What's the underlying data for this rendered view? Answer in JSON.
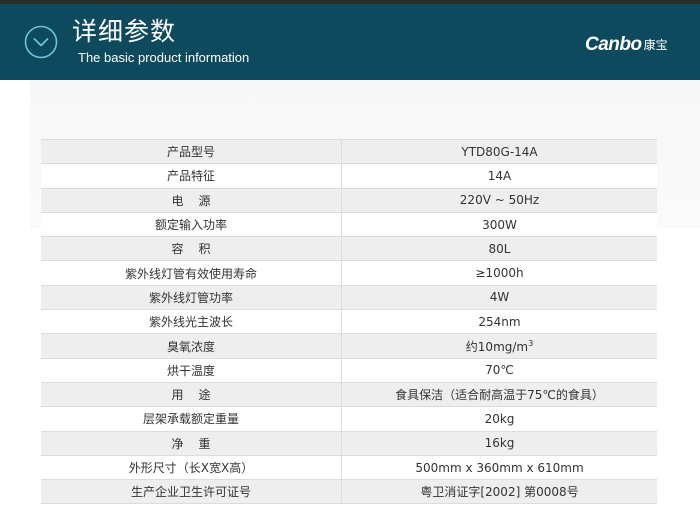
{
  "header": {
    "icon": "chevron-down-circle-icon",
    "title": "详细参数",
    "subtitle": "The basic product information",
    "brand_latin": "Canbo",
    "brand_cn": "康宝",
    "background": "#0d4a5e"
  },
  "specs": [
    {
      "label": "产品型号",
      "value": "YTD80G-14A"
    },
    {
      "label": "产品特征",
      "value": "14A"
    },
    {
      "label": "电源",
      "value": "220V ~ 50Hz"
    },
    {
      "label": "额定输入功率",
      "value": "300W"
    },
    {
      "label": "容积",
      "value": "80L"
    },
    {
      "label": "紫外线灯管有效使用寿命",
      "value": "≥1000h"
    },
    {
      "label": "紫外线灯管功率",
      "value": "4W"
    },
    {
      "label": "紫外线光主波长",
      "value": "254nm"
    },
    {
      "label": "臭氧浓度",
      "value": "约10mg/m",
      "value_sup": "3"
    },
    {
      "label": "烘干温度",
      "value": "70℃"
    },
    {
      "label": "用途",
      "value": "食具保洁（适合耐高温于75℃的食具）"
    },
    {
      "label": "层架承载额定重量",
      "value": "20kg"
    },
    {
      "label": "净重",
      "value": "16kg"
    },
    {
      "label": "外形尺寸（长X宽X高）",
      "value": "500mm x 360mm x 610mm"
    },
    {
      "label": "生产企业卫生许可证号",
      "value": "粤卫消证字[2002] 第0008号"
    }
  ]
}
